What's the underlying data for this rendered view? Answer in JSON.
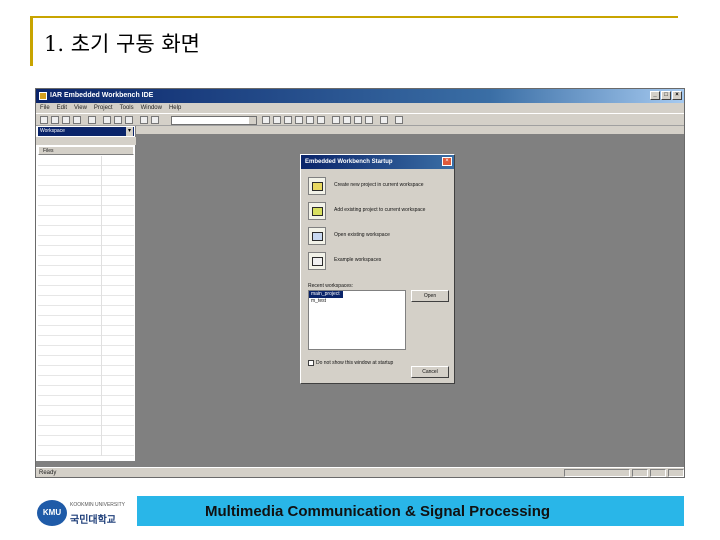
{
  "slide": {
    "title": "1. 초기 구동 화면"
  },
  "ide": {
    "window_title": "IAR Embedded Workbench IDE",
    "menu": [
      "File",
      "Edit",
      "View",
      "Project",
      "Tools",
      "Window",
      "Help"
    ],
    "workspace_combo": "Workspace",
    "files_header": "Files",
    "status": "Ready"
  },
  "dialog": {
    "title": "Embedded Workbench Startup",
    "options": [
      {
        "label": "Create new project in current workspace",
        "icon": "new-project-icon"
      },
      {
        "label": "Add existing project to current workspace",
        "icon": "add-project-icon"
      },
      {
        "label": "Open existing workspace",
        "icon": "open-workspace-icon"
      },
      {
        "label": "Example workspaces",
        "icon": "example-workspace-icon"
      }
    ],
    "recent_label": "Recent workspaces:",
    "recent": [
      "main_project",
      "m_test"
    ],
    "open_button": "Open",
    "checkbox_label": "Do not show this window at startup",
    "cancel_button": "Cancel"
  },
  "footer": {
    "logo_mark": "KMU",
    "logo_sub": "KOOKMIN UNIVERSITY",
    "logo_name": "국민대학교",
    "banner": "Multimedia Communication & Signal Processing"
  },
  "colors": {
    "title_rule": "#c8a400",
    "banner_bg": "#29b6e8",
    "ide_bg": "#808080"
  }
}
